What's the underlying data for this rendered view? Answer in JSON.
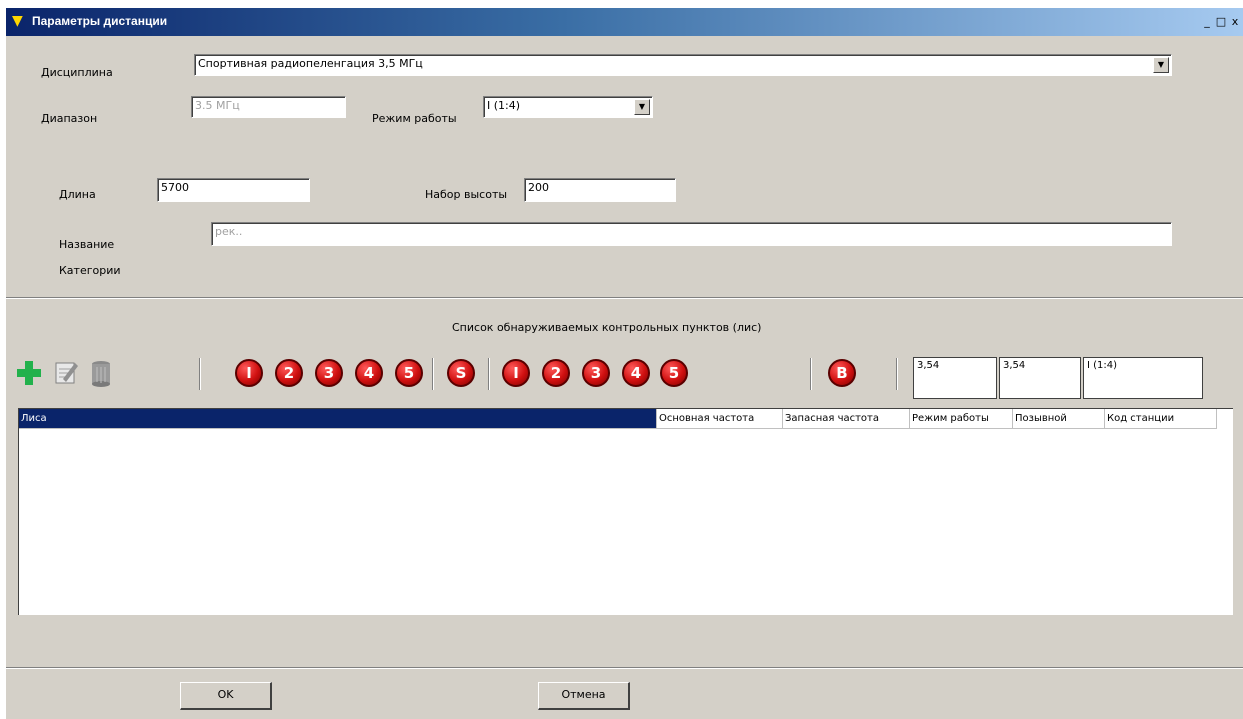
{
  "window": {
    "title": "Параметры дистанции",
    "min_label": "_",
    "max_label": "□",
    "close_label": "x"
  },
  "form": {
    "discipline_label": "Дисциплина",
    "discipline_value": "Спортивная радиопеленгация 3,5 МГц",
    "range_label": "Диапазон",
    "range_value": "3.5 МГц",
    "mode_label": "Режим работы",
    "mode_value": "I (1:4)",
    "length_label": "Длина",
    "length_value": "5700",
    "climb_label": "Набор высоты",
    "climb_value": "200",
    "category_label_1": "Название",
    "category_label_2": "Категории",
    "category_placeholder": "рек.."
  },
  "list_title": "Список обнаруживаемых контрольных пунктов (лис)",
  "toolbar": {
    "group1": [
      "I",
      "2",
      "3",
      "4",
      "5"
    ],
    "group1_s": "S",
    "group2": [
      "I",
      "2",
      "3",
      "4",
      "5"
    ],
    "group2_b": "B",
    "freq1": "3,54",
    "freq2": "3,54",
    "mode": "I (1:4)"
  },
  "grid": {
    "columns": [
      "Лиса",
      "Основная частота",
      "Запасная частота",
      "Режим работы",
      "Позывной",
      "Код станции"
    ]
  },
  "buttons": {
    "ok": "OK",
    "cancel": "Отмена"
  },
  "colors": {
    "accent": "#0a246a",
    "plus_green": "#22b14c",
    "badge_red": "#d01010"
  }
}
